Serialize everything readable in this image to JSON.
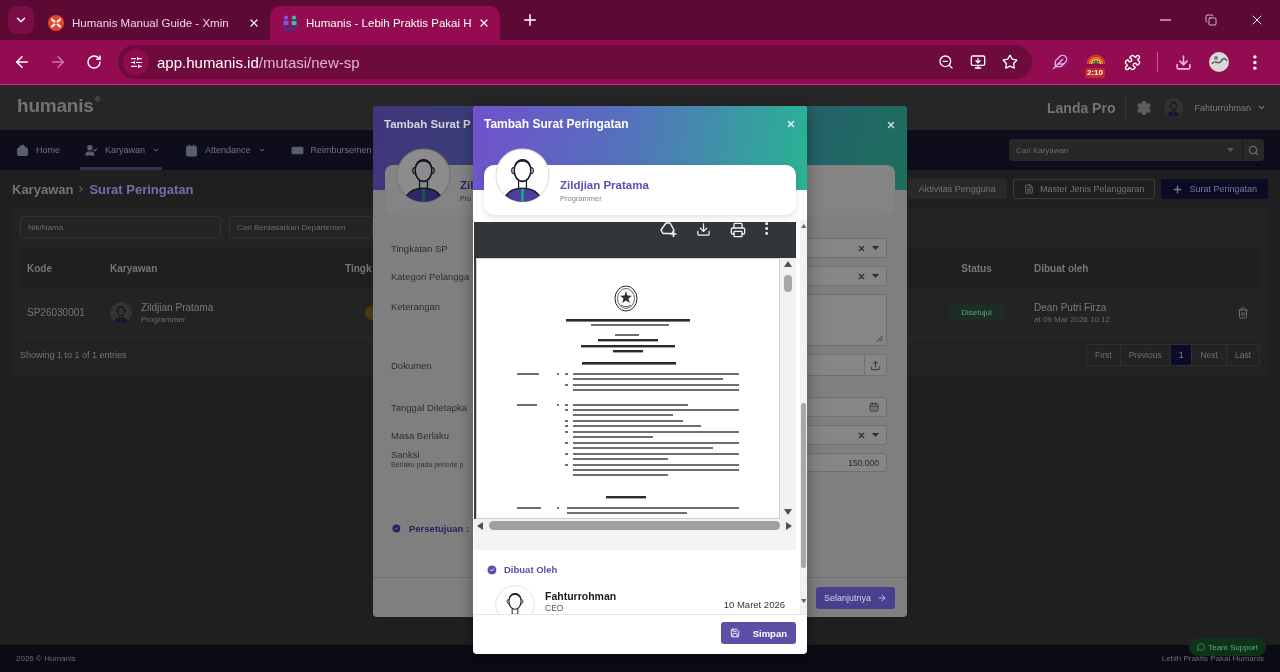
{
  "browser": {
    "tabs": [
      {
        "title": "Humanis Manual Guide - Xmin",
        "selected": false,
        "kind": "mindmap"
      },
      {
        "title": "Humanis - Lebih Praktis Pakai H",
        "selected": true,
        "kind": "people"
      }
    ],
    "url": {
      "host": "app.humanis.id",
      "path": "/mutasi/new-sp"
    },
    "extension_badge": "2:10"
  },
  "app": {
    "logo": "humanis",
    "logo_mark": "®",
    "company": "Landa Pro",
    "user": "Fahturrohman",
    "nav": [
      {
        "label": "Home",
        "selected": false,
        "dropdown": false
      },
      {
        "label": "Karyawan",
        "selected": true,
        "dropdown": true
      },
      {
        "label": "Attendance",
        "selected": false,
        "dropdown": true
      },
      {
        "label": "Reimbursemen",
        "selected": false,
        "dropdown": false
      }
    ],
    "employee_search": {
      "placeholder": "Cari Karyawan"
    },
    "breadcrumb": [
      "Karyawan",
      "Surat Peringatan"
    ],
    "actions": [
      {
        "label": "Aktivitas Pengguna",
        "kind": "soft"
      },
      {
        "label": "Master Jenis Pelanggaran",
        "kind": "outline"
      },
      {
        "label": "Surat Peringatan",
        "kind": "primary"
      }
    ],
    "filters": [
      {
        "placeholder": "Nik/Nama"
      },
      {
        "placeholder": "Cari Berdasarkan Departemen"
      }
    ],
    "table": {
      "columns": [
        "Kode",
        "Karyawan",
        "Tingk",
        "Status",
        "Dibuat oleh"
      ],
      "rows": [
        {
          "code": "SP26030001",
          "name": "Zildjian Pratama",
          "position": "Programmer",
          "level_badge": true,
          "status": "Disetujui",
          "created_by": "Dean Putri Firza",
          "created_at": "at 09 Mar 2026 10:12"
        }
      ]
    },
    "summary": "Showing 1 to 1 of 1 entries",
    "pagination": [
      {
        "label": "First",
        "selected": false
      },
      {
        "label": "Previous",
        "selected": false
      },
      {
        "label": "1",
        "selected": true
      },
      {
        "label": "Next",
        "selected": false
      },
      {
        "label": "Last",
        "selected": false
      }
    ],
    "footer": {
      "copyright": "2026 © Humanis",
      "tagline": "Lebih Praktis Pakai Humanis"
    },
    "support_button": "Team Support"
  },
  "back_dialog": {
    "title": "Tambah Surat P",
    "employee": {
      "name": "Zil",
      "position": "Pro"
    },
    "fields": [
      {
        "label": "Tingkatan SP",
        "kind": "select"
      },
      {
        "label": "Kategori Pelangga",
        "kind": "select"
      },
      {
        "label": "Keterangan",
        "kind": "textarea"
      },
      {
        "label": "Dokumen",
        "kind": "file"
      },
      {
        "label": "Tanggal Ditetapka",
        "kind": "date"
      },
      {
        "label": "Masa Berlaku",
        "kind": "select"
      },
      {
        "label": "Sanksi",
        "hint": "Berlaku pada periode p",
        "kind": "amount",
        "value": "150.000"
      }
    ],
    "approval": "Persetujuan :",
    "next_button": "Selanjutnya"
  },
  "dialog": {
    "title": "Tambah Surat Peringatan",
    "employee": {
      "name": "Zildjian Pratama",
      "position": "Programmer"
    },
    "created": {
      "title": "Dibuat Oleh",
      "name": "Fahturrohman",
      "role": "CEO",
      "date": "10 Maret 2026"
    },
    "save_button": "Simpan"
  }
}
